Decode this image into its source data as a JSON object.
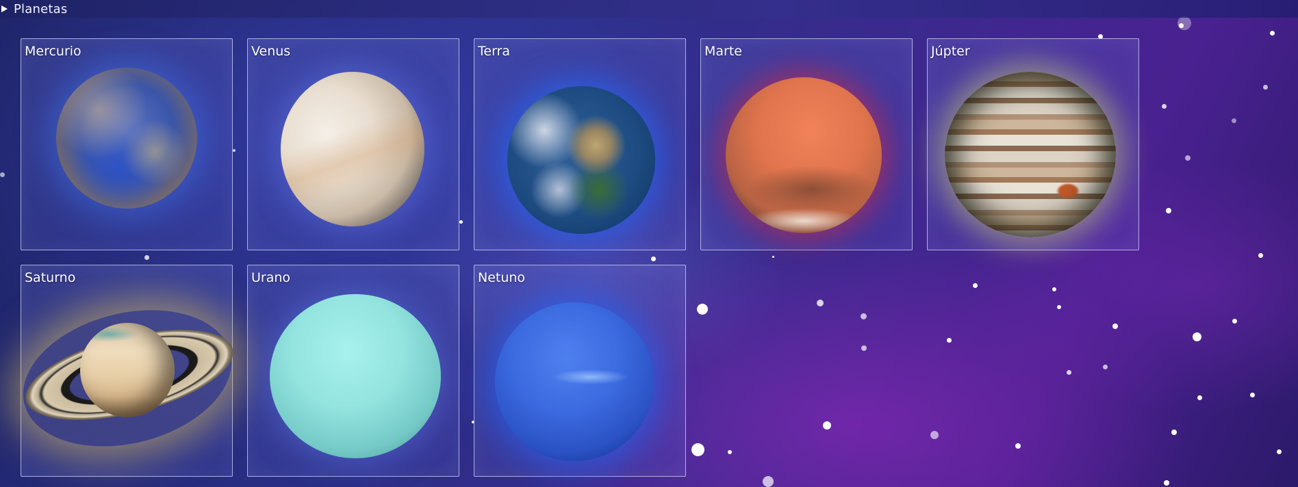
{
  "section": {
    "title": "Planetas",
    "toggle_icon": "triangle-right-icon"
  },
  "planets": [
    {
      "name": "Mercurio"
    },
    {
      "name": "Venus"
    },
    {
      "name": "Terra"
    },
    {
      "name": "Marte"
    },
    {
      "name": "Júpter"
    },
    {
      "name": "Saturno"
    },
    {
      "name": "Urano"
    },
    {
      "name": "Netuno"
    }
  ],
  "colors": {
    "background": "#2a2f86",
    "card_border": "#d2d7ff",
    "text": "#ffffff"
  }
}
